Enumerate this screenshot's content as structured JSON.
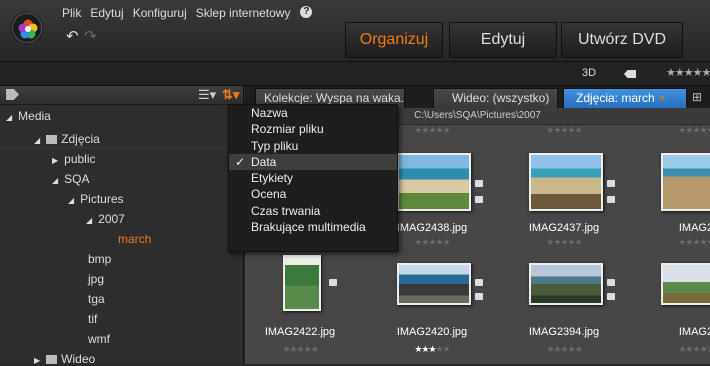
{
  "menu": {
    "file": "Plik",
    "edit": "Edytuj",
    "configure": "Konfiguruj",
    "store": "Sklep internetowy",
    "help": "?"
  },
  "modes": {
    "organize": "Organizuj",
    "edit": "Edytuj",
    "dvd": "Utwórz DVD"
  },
  "strip": {
    "view3d": "3D",
    "rating": "★★★★★"
  },
  "tree": {
    "media": "Media",
    "photos": "Zdjęcia",
    "public": "public",
    "sqa": "SQA",
    "pictures": "Pictures",
    "year": "2007",
    "march": "march",
    "bmp": "bmp",
    "jpg": "jpg",
    "tga": "tga",
    "tif": "tif",
    "wmf": "wmf",
    "video": "Wideo"
  },
  "tabs": {
    "collections": "Kolekcje: Wyspa na waka...",
    "video": "Wideo: (wszystko)",
    "photos": "Zdjęcia: march",
    "close": "×"
  },
  "path": "C:\\Users\\SQA\\Pictures\\2007",
  "sort_menu": {
    "items": [
      "Nazwa",
      "Rozmiar pliku",
      "Typ pliku",
      "Data",
      "Etykiety",
      "Ocena",
      "Czas trwania",
      "Brakujące multimedia"
    ],
    "selected": "Data",
    "check": "✓"
  },
  "thumbs": {
    "row1": [
      "IMAG2438.jpg",
      "IMAG2437.jpg",
      "IMAG2"
    ],
    "row2": [
      "IMAG2422.jpg",
      "IMAG2420.jpg",
      "IMAG2394.jpg",
      "IMAG2"
    ],
    "stars_empty": "★★★★★",
    "rated_on": "★★★",
    "rated_off": "★★"
  },
  "colors": {
    "accent": "#f07a14",
    "tab_active": "#3a85d6",
    "selected_tree": "#f07a14"
  }
}
